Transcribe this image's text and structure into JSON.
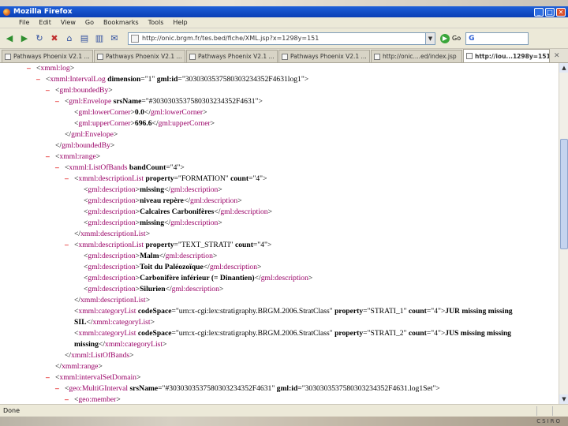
{
  "window": {
    "title": "Mozilla Firefox",
    "minimize": "_",
    "maximize": "□",
    "close": "✕"
  },
  "menu": [
    "File",
    "Edit",
    "View",
    "Go",
    "Bookmarks",
    "Tools",
    "Help"
  ],
  "toolbar": {
    "url": "http://onic.brgm.fr/tes.bed/fiche/XML.jsp?x=1298y=151",
    "go_label": "Go",
    "search_value": ""
  },
  "tabs": [
    {
      "label": "Pathways Phoenix V2.1 ...",
      "active": false
    },
    {
      "label": "Pathways Phoenix V2.1 ...",
      "active": false
    },
    {
      "label": "Pathways Phoenix V2.1 ...",
      "active": false
    },
    {
      "label": "Pathways Phoenix V2.1 ...",
      "active": false
    },
    {
      "label": "http://onic....ed/index.jsp",
      "active": false
    },
    {
      "label": "http://iou...1298y=151",
      "active": true
    }
  ],
  "xml": [
    {
      "indent": 0,
      "minus": "–",
      "html": "&lt;<span class='tag'>xmml:log</span>&gt;"
    },
    {
      "indent": 1,
      "minus": "–",
      "html": "&lt;<span class='tag'>xmml:IntervalLog</span> <span class='attr'>dimension</span>=\"1\" <span class='attr'>gml:id</span>=\"3030303537580303234352F4631log1\"&gt;"
    },
    {
      "indent": 2,
      "minus": "–",
      "html": "&lt;<span class='tag'>gml:boundedBy</span>&gt;"
    },
    {
      "indent": 3,
      "minus": "–",
      "html": "&lt;<span class='tag'>gml:Envelope</span> <span class='attr'>srsName</span>=\"#3030303537580303234352F4631\"&gt;"
    },
    {
      "indent": 4,
      "minus": "",
      "html": "&lt;<span class='tag'>gml:lowerCorner</span>&gt;<span class='txt'>0.0</span>&lt;/<span class='tag'>gml:lowerCorner</span>&gt;"
    },
    {
      "indent": 4,
      "minus": "",
      "html": "&lt;<span class='tag'>gml:upperCorner</span>&gt;<span class='txt'>696.6</span>&lt;/<span class='tag'>gml:upperCorner</span>&gt;"
    },
    {
      "indent": 3,
      "minus": "",
      "html": "&lt;/<span class='tag'>gml:Envelope</span>&gt;"
    },
    {
      "indent": 2,
      "minus": "",
      "html": "&lt;/<span class='tag'>gml:boundedBy</span>&gt;"
    },
    {
      "indent": 2,
      "minus": "–",
      "html": "&lt;<span class='tag'>xmml:range</span>&gt;"
    },
    {
      "indent": 3,
      "minus": "–",
      "html": "&lt;<span class='tag'>xmml:ListOfBands</span> <span class='attr'>bandCount</span>=\"4\"&gt;"
    },
    {
      "indent": 4,
      "minus": "–",
      "html": "&lt;<span class='tag'>xmml:descriptionList</span> <span class='attr'>property</span>=\"FORMATION\" <span class='attr'>count</span>=\"4\"&gt;"
    },
    {
      "indent": 5,
      "minus": "",
      "html": "&lt;<span class='tag'>gml:description</span>&gt;<span class='txt'>missing</span>&lt;/<span class='tag'>gml:description</span>&gt;"
    },
    {
      "indent": 5,
      "minus": "",
      "html": "&lt;<span class='tag'>gml:description</span>&gt;<span class='txt'>niveau repère</span>&lt;/<span class='tag'>gml:description</span>&gt;"
    },
    {
      "indent": 5,
      "minus": "",
      "html": "&lt;<span class='tag'>gml:description</span>&gt;<span class='txt'>Calcaires Carbonifères</span>&lt;/<span class='tag'>gml:description</span>&gt;"
    },
    {
      "indent": 5,
      "minus": "",
      "html": "&lt;<span class='tag'>gml:description</span>&gt;<span class='txt'>missing</span>&lt;/<span class='tag'>gml:description</span>&gt;"
    },
    {
      "indent": 4,
      "minus": "",
      "html": "&lt;/<span class='tag'>xmml:descriptionList</span>&gt;"
    },
    {
      "indent": 4,
      "minus": "–",
      "html": "&lt;<span class='tag'>xmml:descriptionList</span> <span class='attr'>property</span>=\"TEXT_STRATI\" <span class='attr'>count</span>=\"4\"&gt;"
    },
    {
      "indent": 5,
      "minus": "",
      "html": "&lt;<span class='tag'>gml:description</span>&gt;<span class='txt'>Malm</span>&lt;/<span class='tag'>gml:description</span>&gt;"
    },
    {
      "indent": 5,
      "minus": "",
      "html": "&lt;<span class='tag'>gml:description</span>&gt;<span class='txt'>Toit du Paléozoïque</span>&lt;/<span class='tag'>gml:description</span>&gt;"
    },
    {
      "indent": 5,
      "minus": "",
      "html": "&lt;<span class='tag'>gml:description</span>&gt;<span class='txt'>Carbonifère inférieur (= Dinantien)</span>&lt;/<span class='tag'>gml:description</span>&gt;"
    },
    {
      "indent": 5,
      "minus": "",
      "html": "&lt;<span class='tag'>gml:description</span>&gt;<span class='txt'>Silurien</span>&lt;/<span class='tag'>gml:description</span>&gt;"
    },
    {
      "indent": 4,
      "minus": "",
      "html": "&lt;/<span class='tag'>xmml:descriptionList</span>&gt;"
    },
    {
      "indent": 4,
      "minus": "",
      "html": "&lt;<span class='tag'>xmml:categoryList</span> <span class='attr'>codeSpace</span>=\"urn:x-cgi:lex:stratigraphy.BRGM.2006.StratClass\" <span class='attr'>property</span>=\"STRATI_1\" <span class='attr'>count</span>=\"4\"&gt;<span class='txt'>JUR missing missing</span>"
    },
    {
      "indent": 4,
      "minus": "",
      "html": "<span class='txt'>SIL</span>&lt;/<span class='tag'>xmml:categoryList</span>&gt;"
    },
    {
      "indent": 4,
      "minus": "",
      "html": "&lt;<span class='tag'>xmml:categoryList</span> <span class='attr'>codeSpace</span>=\"urn:x-cgi:lex:stratigraphy.BRGM.2006.StratClass\" <span class='attr'>property</span>=\"STRATI_2\" <span class='attr'>count</span>=\"4\"&gt;<span class='txt'>JUS missing missing</span>"
    },
    {
      "indent": 4,
      "minus": "",
      "html": "<span class='txt'>missing</span>&lt;/<span class='tag'>xmml:categoryList</span>&gt;"
    },
    {
      "indent": 3,
      "minus": "",
      "html": "&lt;/<span class='tag'>xmml:ListOfBands</span>&gt;"
    },
    {
      "indent": 2,
      "minus": "",
      "html": "&lt;/<span class='tag'>xmml:range</span>&gt;"
    },
    {
      "indent": 2,
      "minus": "–",
      "html": "&lt;<span class='tag'>xmml:intervalSetDomain</span>&gt;"
    },
    {
      "indent": 3,
      "minus": "–",
      "html": "&lt;<span class='tag'>geo:MultiGInterval</span> <span class='attr'>srsName</span>=\"#3030303537580303234352F4631\" <span class='attr'>gml:id</span>=\"3030303537580303234352F4631.log1Set\"&gt;"
    },
    {
      "indent": 4,
      "minus": "–",
      "html": "&lt;<span class='tag'>geo:member</span>&gt;"
    }
  ],
  "status": "Done",
  "taskbar": {
    "brand": "CSIRO"
  }
}
